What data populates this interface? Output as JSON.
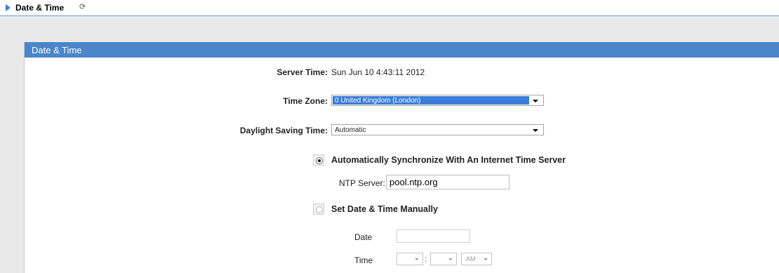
{
  "header": {
    "title": "Date & Time",
    "refresh_glyph": "⟳"
  },
  "panel": {
    "title": "Date & Time"
  },
  "server_time": {
    "label": "Server Time:",
    "value": "Sun Jun 10 4:43:11 2012"
  },
  "time_zone": {
    "label": "Time Zone:",
    "selected": "0 United Kingdom (London)"
  },
  "daylight_saving": {
    "label": "Daylight Saving Time:",
    "selected": "Automatic"
  },
  "sync_option": {
    "label": "Automatically Synchronize With An Internet Time Server",
    "checked": true
  },
  "ntp": {
    "label": "NTP Server:",
    "value": "pool.ntp.org"
  },
  "manual_option": {
    "label": "Set Date & Time Manually",
    "checked": false
  },
  "date": {
    "label": "Date",
    "value": ""
  },
  "time": {
    "label": "Time",
    "separator": ":",
    "ampm": "AM"
  },
  "colors": {
    "accent": "#4a86c9",
    "header_arrow": "#3b7dd8",
    "background": "#e9e9e9"
  }
}
